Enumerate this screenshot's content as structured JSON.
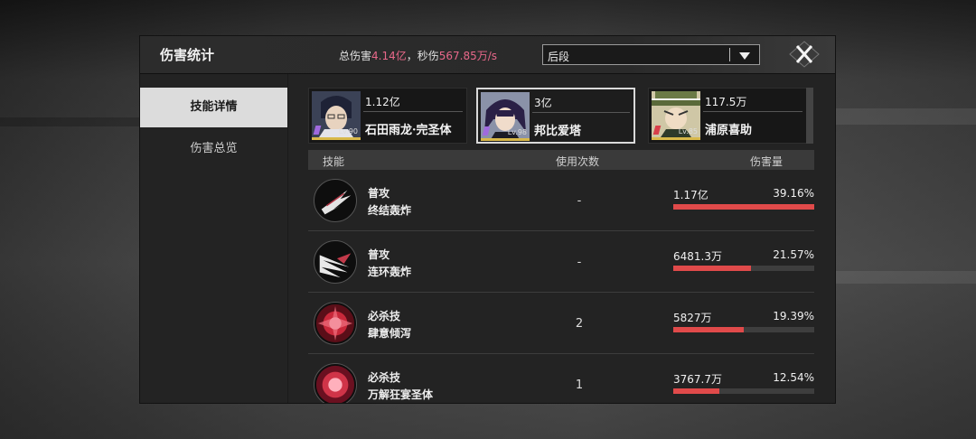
{
  "header": {
    "title": "伤害统计",
    "summary_prefix": "总伤害",
    "total_damage": "4.14亿",
    "summary_mid": "，秒伤",
    "dps": "567.85万/s",
    "filter_value": "后段"
  },
  "sidebar": {
    "items": [
      {
        "label": "技能详情",
        "active": true
      },
      {
        "label": "伤害总览",
        "active": false
      }
    ]
  },
  "characters": [
    {
      "damage": "1.12亿",
      "name": "石田雨龙·完圣体",
      "level": "Lv.90",
      "selected": false
    },
    {
      "damage": "3亿",
      "name": "邦比爱塔",
      "level": "Lv.98",
      "selected": true
    },
    {
      "damage": "117.5万",
      "name": "浦原喜助",
      "level": "Lv.85",
      "selected": false
    }
  ],
  "table": {
    "headers": [
      "技能",
      "使用次数",
      "伤害量"
    ],
    "rows": [
      {
        "type": "普攻",
        "name": "终结轰炸",
        "count": "-",
        "damage": "1.17亿",
        "percent": "39.16%",
        "ratio": 1.0,
        "icon": "blade-slash-icon"
      },
      {
        "type": "普攻",
        "name": "连环轰炸",
        "count": "-",
        "damage": "6481.3万",
        "percent": "21.57%",
        "ratio": 0.55,
        "icon": "wing-slash-icon"
      },
      {
        "type": "必杀技",
        "name": "肆意倾泻",
        "count": "2",
        "damage": "5827万",
        "percent": "19.39%",
        "ratio": 0.5,
        "icon": "explosion-burst-icon"
      },
      {
        "type": "必杀技",
        "name": "万解狂宴圣体",
        "count": "1",
        "damage": "3767.7万",
        "percent": "12.54%",
        "ratio": 0.33,
        "icon": "crimson-orb-icon"
      }
    ]
  },
  "colors": {
    "accent_pink": "#e8688a",
    "bar_red": "#e04a4a"
  }
}
